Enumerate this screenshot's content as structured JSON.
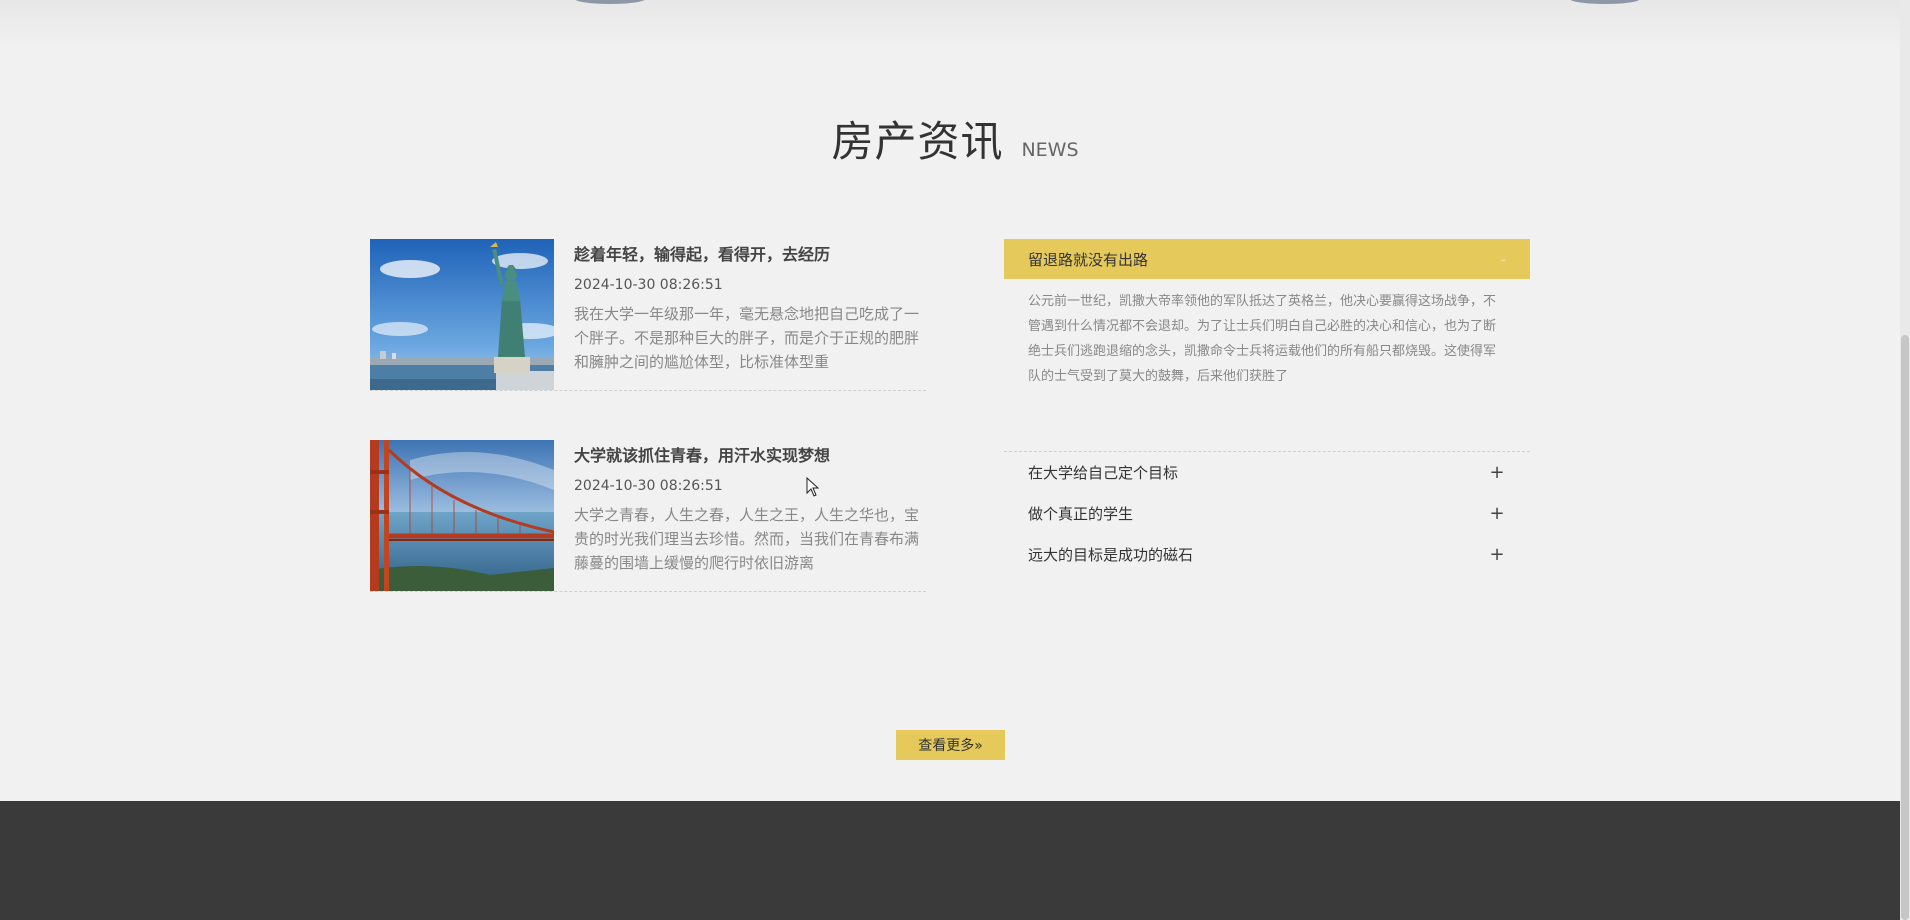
{
  "section": {
    "title_cn": "房产资讯",
    "title_en": "NEWS"
  },
  "news": [
    {
      "title": "趁着年轻，输得起，看得开，去经历",
      "date": "2024-10-30 08:26:51",
      "desc": "我在大学一年级那一年，毫无悬念地把自己吃成了一个胖子。不是那种巨大的胖子，而是介于正规的肥胖和臃肿之间的尴尬体型，比标准体型重",
      "image": "statue-of-liberty-photo"
    },
    {
      "title": "大学就该抓住青春，用汗水实现梦想",
      "date": "2024-10-30 08:26:51",
      "desc": "大学之青春，人生之春，人生之王，人生之华也，宝贵的时光我们理当去珍惜。然而，当我们在青春布满藤蔓的围墙上缓慢的爬行时依旧游离",
      "image": "golden-gate-bridge-photo"
    }
  ],
  "accordion": {
    "active": {
      "title": "留退路就没有出路",
      "body": "公元前一世纪，凯撒大帝率领他的军队抵达了英格兰，他决心要赢得这场战争，不管遇到什么情况都不会退却。为了让士兵们明白自己必胜的决心和信心，也为了断绝士兵们逃跑退缩的念头，凯撒命令士兵将运载他们的所有船只都烧毁。这使得军队的士气受到了莫大的鼓舞，后来他们获胜了"
    },
    "items": [
      {
        "title": "在大学给自己定个目标"
      },
      {
        "title": "做个真正的学生"
      },
      {
        "title": "远大的目标是成功的磁石"
      }
    ],
    "expand_symbol": "+",
    "collapse_symbol": "-"
  },
  "more_button": {
    "label": "查看更多»"
  },
  "colors": {
    "accent": "#e5c95a",
    "footer": "#3a3a3a",
    "background": "#f1f1f1"
  }
}
